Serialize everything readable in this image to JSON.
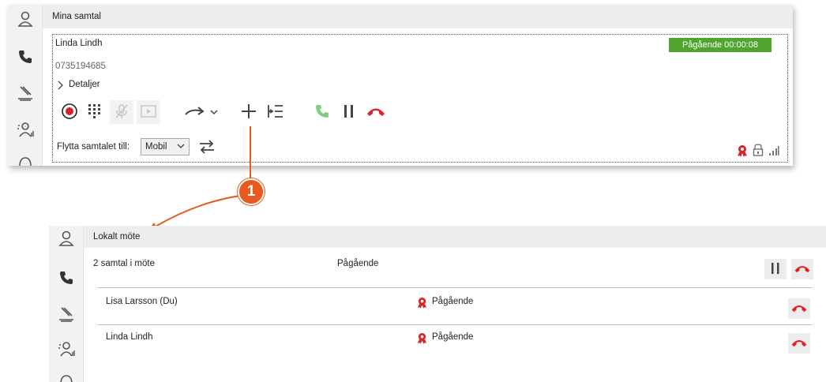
{
  "top_window": {
    "header_title": "Mina samtal",
    "caller_name": "Linda Lindh",
    "caller_number": "0735194685",
    "details_label": "Detaljer",
    "status": "Pågående 00:00:08",
    "move_label": "Flytta samtalet till:",
    "move_option": "Mobil"
  },
  "callout": {
    "number": "1"
  },
  "bottom_window": {
    "header_title": "Lokalt möte",
    "summary_label": "2 samtal i möte",
    "summary_status": "Pågående",
    "participants": [
      {
        "name": "Lisa Larsson (Du)",
        "status": "Pågående"
      },
      {
        "name": "Linda Lindh",
        "status": "Pågående"
      }
    ]
  },
  "colors": {
    "status_green": "#4fa52d",
    "hangup_red": "#e0202a",
    "answer_green": "#7ed07e",
    "record_red": "#d8212a",
    "callout_orange": "#e8591f",
    "icon_gray": "#555555"
  },
  "icons": [
    "person-icon",
    "phone-icon",
    "switchboard-icon",
    "group-icon",
    "headset-icon",
    "record-icon",
    "keypad-icon",
    "mute-icon",
    "screen-icon",
    "transfer-icon",
    "add-call-icon",
    "call-list-icon",
    "answer-icon",
    "pause-icon",
    "hangup-icon",
    "swap-icon",
    "badge-icon",
    "lock-icon",
    "signal-icon"
  ]
}
